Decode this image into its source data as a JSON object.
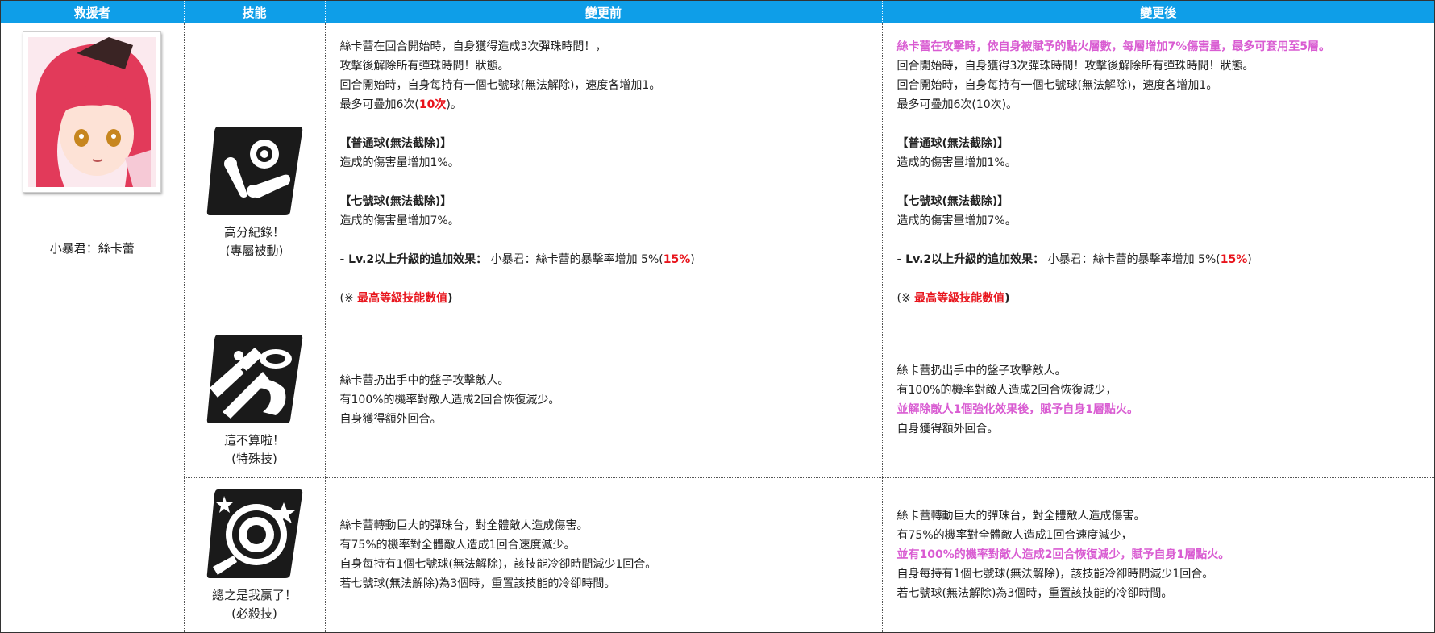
{
  "headers": {
    "rescuer": "救援者",
    "skill": "技能",
    "before": "變更前",
    "after": "變更後"
  },
  "rescuer": {
    "name": "小暴君：絲卡蕾",
    "portrait_icon": "character-portrait"
  },
  "colors": {
    "header_bg": "#0e9ee8",
    "highlight_red": "#e8141c",
    "highlight_pink": "#d95cd2"
  },
  "skills": [
    {
      "name": "高分紀錄！",
      "type": "(專屬被動)",
      "icon": "pinball-flipper-icon",
      "before": {
        "l1": "絲卡蕾在回合開始時，自身獲得造成3次彈珠時間！，",
        "l2": "攻擊後解除所有彈珠時間！狀態。",
        "l3": "回合開始時，自身每持有一個七號球(無法解除)，速度各增加1。",
        "l4a": "最多可疊加6次(",
        "l4b": "10次",
        "l4c": ")。",
        "h1": "【普通球(無法截除)】",
        "l5": "造成的傷害量增加1%。",
        "h2": "【七號球(無法截除)】",
        "l6": "造成的傷害量增加7%。",
        "lv_a": "- Lv.2以上升級的追加效果：",
        "lv_b": " 小暴君：絲卡蕾的暴擊率增加 5%(",
        "lv_c": "15%",
        "lv_d": ")",
        "note_a": "(※ ",
        "note_b": "最高等級技能數值",
        "note_c": ")"
      },
      "after": {
        "p1": "絲卡蕾在攻擊時，依自身被賦予的點火層數，每層增加7%傷害量，最多可套用至5層。",
        "l2": "回合開始時，自身獲得3次彈珠時間！攻擊後解除所有彈珠時間！狀態。",
        "l3": "回合開始時，自身每持有一個七號球(無法解除)，速度各增加1。",
        "l4": "最多可疊加6次(10次)。",
        "h1": "【普通球(無法截除)】",
        "l5": "造成的傷害量增加1%。",
        "h2": "【七號球(無法截除)】",
        "l6": "造成的傷害量增加7%。",
        "lv_a": "- Lv.2以上升級的追加效果：",
        "lv_b": " 小暴君：絲卡蕾的暴擊率增加 5%(",
        "lv_c": "15%",
        "lv_d": ")",
        "note_a": "(※ ",
        "note_b": "最高等級技能數值",
        "note_c": ")"
      }
    },
    {
      "name": "這不算啦！",
      "type": "(特殊技)",
      "icon": "plate-throw-icon",
      "before": {
        "l1": "絲卡蕾扔出手中的盤子攻擊敵人。",
        "l2": "有100%的機率對敵人造成2回合恢復減少。",
        "l3": "自身獲得額外回合。"
      },
      "after": {
        "l1": "絲卡蕾扔出手中的盤子攻擊敵人。",
        "l2": "有100%的機率對敵人造成2回合恢復減少，",
        "p3": "並解除敵人1個強化效果後，賦予自身1層點火。",
        "l4": "自身獲得額外回合。"
      }
    },
    {
      "name": "總之是我贏了！",
      "type": "(必殺技)",
      "icon": "pinball-table-icon",
      "before": {
        "l1": "絲卡蕾轉動巨大的彈珠台，對全體敵人造成傷害。",
        "l2": "有75%的機率對全體敵人造成1回合速度減少。",
        "l3": "自身每持有1個七號球(無法解除)，該技能冷卻時間減少1回合。",
        "l4": "若七號球(無法解除)為3個時，重置該技能的冷卻時間。"
      },
      "after": {
        "l1": "絲卡蕾轉動巨大的彈珠台，對全體敵人造成傷害。",
        "l2": "有75%的機率對全體敵人造成1回合速度減少，",
        "p3": "並有100%的機率對敵人造成2回合恢復減少，賦予自身1層點火。",
        "l4": "自身每持有1個七號球(無法解除)，該技能冷卻時間減少1回合。",
        "l5": "若七號球(無法解除)為3個時，重置該技能的冷卻時間。"
      }
    }
  ]
}
